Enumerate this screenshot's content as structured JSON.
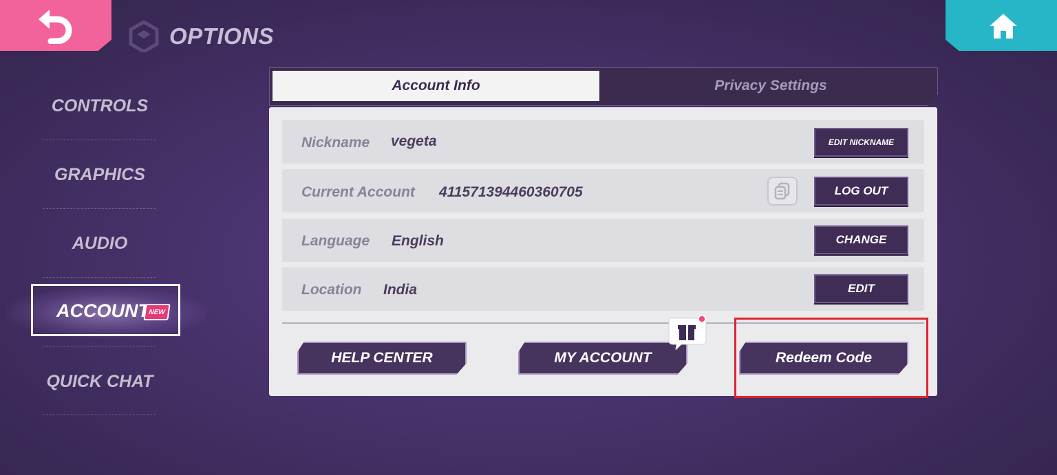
{
  "header": {
    "back_icon": "back-arrow-icon",
    "home_icon": "home-icon",
    "title": "OPTIONS",
    "colors": {
      "back": "#f3639b",
      "home": "#27b6c7"
    }
  },
  "sidebar": {
    "items": [
      {
        "label": "CONTROLS"
      },
      {
        "label": "GRAPHICS"
      },
      {
        "label": "AUDIO"
      },
      {
        "label": "ACCOUNT",
        "badge": "NEW",
        "active": true
      },
      {
        "label": "QUICK CHAT"
      }
    ]
  },
  "tabs": [
    {
      "label": "Account Info",
      "active": true
    },
    {
      "label": "Privacy Settings",
      "active": false
    }
  ],
  "account": {
    "nickname": {
      "label": "Nickname",
      "value": "vegeta",
      "button": "EDIT NICKNAME"
    },
    "current_account": {
      "label": "Current Account",
      "value": "411571394460360705",
      "copy_icon": "copy-icon",
      "button": "LOG OUT"
    },
    "language": {
      "label": "Language",
      "value": "English",
      "button": "CHANGE"
    },
    "location": {
      "label": "Location",
      "value": "India",
      "button": "EDIT"
    }
  },
  "actions": {
    "help_center": "HELP CENTER",
    "my_account": "MY ACCOUNT",
    "redeem_code": "Redeem Code",
    "gift_icon": "gift-icon"
  },
  "highlight_color": "#e0232e"
}
